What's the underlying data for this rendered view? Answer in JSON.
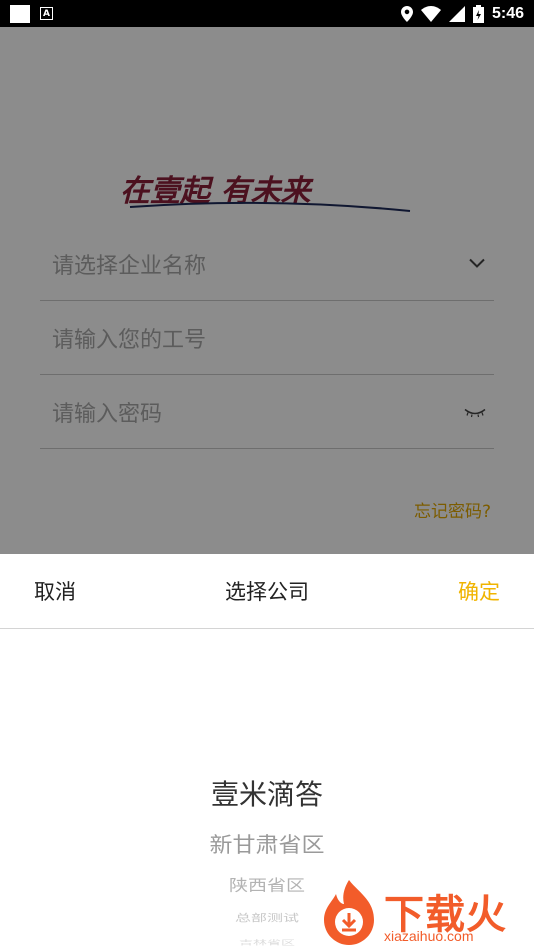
{
  "status_bar": {
    "time": "5:46"
  },
  "background": {
    "logo_text": "在壹起 有未来",
    "fields": {
      "company": "请选择企业名称",
      "employee_id": "请输入您的工号",
      "password": "请输入密码"
    },
    "forgot_password": "忘记密码?"
  },
  "sheet": {
    "cancel": "取消",
    "title": "选择公司",
    "confirm": "确定"
  },
  "picker": {
    "items": [
      "壹米滴答",
      "新甘肃省区",
      "陕西省区",
      "总部测试",
      "吉林省区"
    ],
    "selected_index": 0
  },
  "watermark": {
    "text": "下载火",
    "url": "xiazaihuo.com"
  },
  "colors": {
    "accent": "#f0b400",
    "forgot": "#e2a800",
    "watermark": "#f25c2a"
  }
}
